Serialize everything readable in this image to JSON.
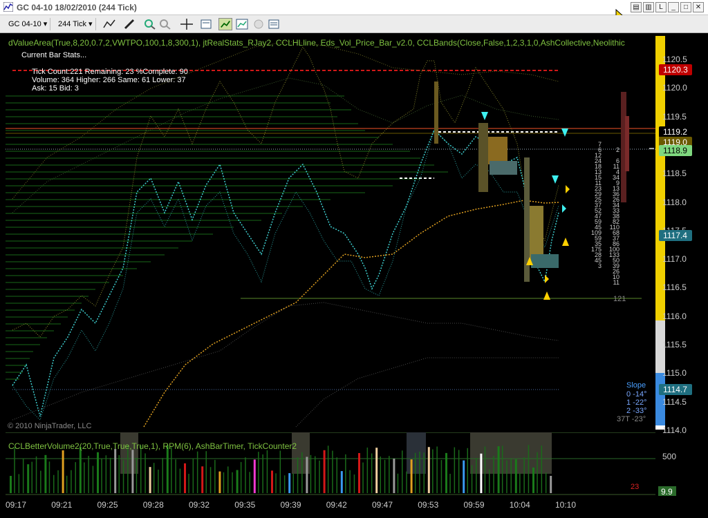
{
  "window": {
    "title": "GC 04-10  18/02/2010 (244 Tick)",
    "controls": [
      "L",
      "_",
      "□",
      "✕"
    ]
  },
  "toolbar": {
    "instrument": "GC 04-10",
    "period": "244 Tick"
  },
  "chart": {
    "indicators_label": "dValueArea(True,8,20,0.7,2,VWTPO,100,1,8,300,1),  jtRealStats_RJay2,  CCLHLline,  Eds_Vol_Price_Bar_v2.0,  CCLBands(Close,False,1,2,3,1,0,AshCollective,Neolithic",
    "stats_title": "Current Bar Stats...",
    "stats_lines": [
      "Tick Count:221   Remaining: 23   %Complete: 90",
      "Volume: 364   Higher: 266   Same: 61   Lower: 37",
      "Ask: 15   Bid: 3"
    ],
    "copyright": "© 2010 NinjaTrader, LLC",
    "bar_count_label": "121",
    "slope": {
      "title": "Slope",
      "rows": [
        "0  -14°",
        "1  -22°",
        "2  -33°",
        "37T  -23°"
      ]
    },
    "delta_ladder": {
      "left": [
        "7",
        "6",
        "12",
        "24",
        "18",
        "13",
        "15",
        "11",
        "23",
        "29",
        "25",
        "37",
        "52",
        "47",
        "59",
        "45",
        "109",
        "59",
        "35",
        "175",
        "28",
        "45",
        "3"
      ],
      "right": [
        "2",
        "",
        "6",
        "11",
        "4",
        "34",
        "9",
        "13",
        "36",
        "26",
        "34",
        "33",
        "38",
        "82",
        "110",
        "68",
        "37",
        "86",
        "100",
        "133",
        "50",
        "39",
        "26",
        "10",
        "11"
      ]
    }
  },
  "price_axis": {
    "ticks": [
      "1120.5",
      "1120.0",
      "1119.5",
      "1119.0",
      "1118.5",
      "1118.0",
      "1117.5",
      "1117.0",
      "1116.5",
      "1116.0",
      "1115.5",
      "1115.0",
      "1114.5",
      "1114.0"
    ],
    "tags": [
      {
        "label": "1120.3",
        "bg": "#c00000",
        "fg": "#ffffff"
      },
      {
        "label": "1119.2",
        "bg": "#000000",
        "fg": "#ffffff"
      },
      {
        "label": "1119.0",
        "bg": "#6b5a00",
        "fg": "#ffffff"
      },
      {
        "label": "1118.9",
        "bg": "#7fd87f",
        "fg": "#000000"
      },
      {
        "label": "1117.4",
        "bg": "#1f6f80",
        "fg": "#ffffff"
      },
      {
        "label": "1114.7",
        "bg": "#1f6f80",
        "fg": "#ffffff"
      }
    ]
  },
  "sub_panel": {
    "indicators_label": "CCLBetterVolume2(20,True,True,True,1),  RPM(6),  AshBarTimer,  TickCounter2",
    "axis_label": "500",
    "value_tag": "9.9",
    "counter": "23"
  },
  "time_axis": {
    "labels": [
      "09:17",
      "09:21",
      "09:25",
      "09:28",
      "09:32",
      "09:35",
      "09:39",
      "09:42",
      "09:47",
      "09:53",
      "09:59",
      "10:04",
      "10:10"
    ]
  },
  "colors": {
    "indicator_text": "#7fc241",
    "price_line": "#3ecfd0",
    "band": "#7a7a2a",
    "ma": "#e0a020",
    "red_line": "#d01818",
    "yellow_bar": "#f0d000"
  }
}
